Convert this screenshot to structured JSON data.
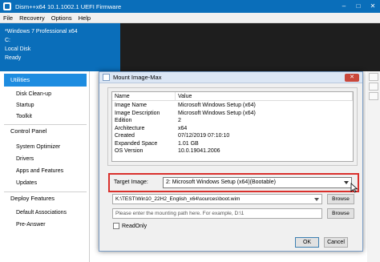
{
  "window": {
    "title": "Dism++x64 10.1.1002.1 UEFI Firmware",
    "controls": [
      "–",
      "□",
      "✕"
    ]
  },
  "menu": [
    "File",
    "Recovery",
    "Options",
    "Help"
  ],
  "session": {
    "os": "*Windows 7 Professional x64",
    "drive": "C:",
    "disk": "Local Disk",
    "status": "Ready"
  },
  "sidebar": {
    "utilities": "Utilities",
    "utilities_items": [
      "Disk Clean-up",
      "Startup",
      "Toolkit"
    ],
    "control_panel": "Control Panel",
    "control_items": [
      "System Optimizer",
      "Drivers",
      "Apps and Features",
      "Updates"
    ],
    "deploy": "Deploy Features",
    "deploy_items": [
      "Default Associations",
      "Pre-Answer"
    ]
  },
  "dialog": {
    "title": "Mount Image-Max",
    "table": {
      "headers": [
        "Name",
        "Value"
      ],
      "rows": [
        [
          "Image Name",
          "Microsoft Windows Setup (x64)"
        ],
        [
          "Image Description",
          "Microsoft Windows Setup (x64)"
        ],
        [
          "Edition",
          "2"
        ],
        [
          "Architecture",
          "x64"
        ],
        [
          "Created",
          "07/12/2019 07:10:10"
        ],
        [
          "Expanded Space",
          "1.01 GB"
        ],
        [
          "OS Version",
          "10.0.19041.2006"
        ]
      ]
    },
    "target_label": "Target Image:",
    "target_value": "2: Microsoft Windows Setup (x64)(Bootable)",
    "image_path": "K:\\TEST\\Win10_22H2_English_x64\\sources\\boot.wim",
    "mount_path_placeholder": "Please enter the mounting path here. For example, D:\\1",
    "browse_label": "Browse",
    "readonly_label": "ReadOnly",
    "ok_label": "OK",
    "cancel_label": "Cancel"
  },
  "colors": {
    "titlebar": "#0a6eba",
    "highlight": "#d9302c",
    "sidebar_active": "#1d8ce0"
  }
}
